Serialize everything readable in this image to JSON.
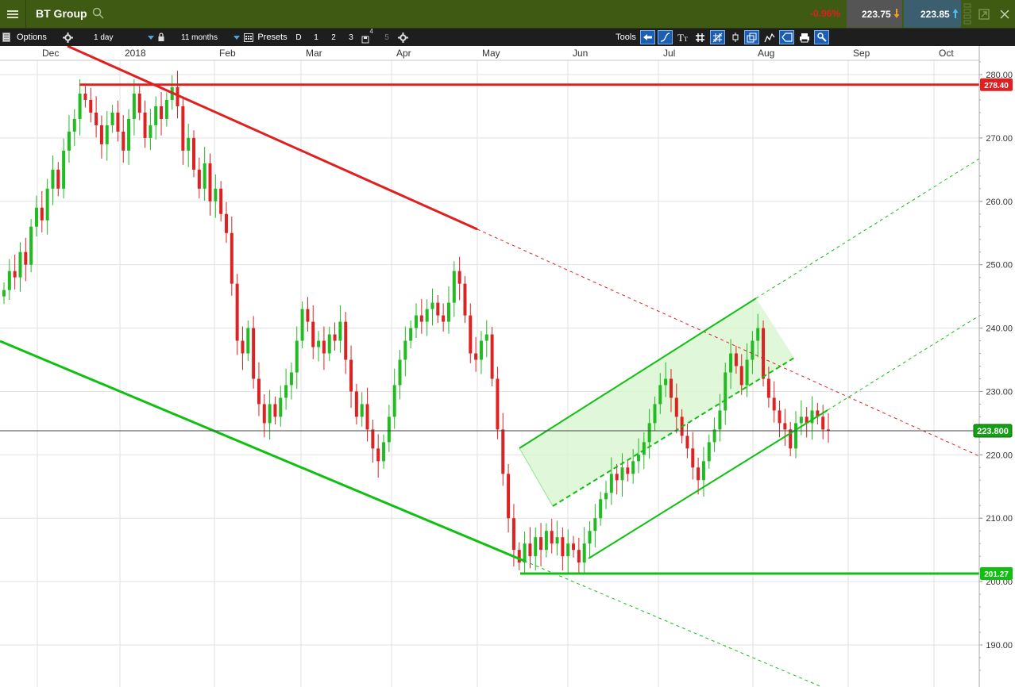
{
  "header": {
    "title": "BT Group",
    "change": "-0.96%",
    "sell_price": "223.75",
    "buy_price": "223.85"
  },
  "toolbar": {
    "options_label": "Options",
    "interval": "1 day",
    "range": "11 months",
    "presets_label": "Presets",
    "presets": [
      "D",
      "1",
      "2",
      "3",
      "4",
      "5"
    ],
    "tools_label": "Tools"
  },
  "colors": {
    "header_bg": "#3f5a12",
    "toolbar_bg": "#1e1e1e",
    "up_candle": "#22bb22",
    "down_candle": "#dd2222",
    "resistance": "#e02020",
    "support": "#10c010",
    "channel_fill": "#d8f5d0"
  },
  "chart_data": {
    "type": "candlestick",
    "x_tick_labels": [
      "Dec",
      "2018",
      "Feb",
      "Mar",
      "Apr",
      "May",
      "Jun",
      "Jul",
      "Aug",
      "Sep",
      "Oct"
    ],
    "y_tick_labels": [
      "280.00",
      "270.00",
      "260.00",
      "250.00",
      "240.00",
      "230.00",
      "220.00",
      "210.00",
      "200.00",
      "190.00"
    ],
    "ylim": [
      184,
      282
    ],
    "grid": true,
    "current_price_label": "223.800",
    "resistance_label": "278.40",
    "support_label": "201.27",
    "closes": [
      246,
      249,
      248,
      252,
      250,
      256,
      259,
      257,
      262,
      265,
      262,
      268,
      271,
      273,
      277,
      276,
      274,
      272,
      269,
      272,
      274,
      271,
      268,
      273,
      277,
      274,
      270,
      272,
      275,
      273,
      276,
      278,
      275,
      268,
      270,
      265,
      262,
      266,
      260,
      262,
      258,
      255,
      247,
      238,
      236,
      240,
      232,
      228,
      225,
      228,
      226,
      229,
      231,
      233,
      238,
      243,
      241,
      237,
      238,
      236,
      239,
      238,
      241,
      235,
      230,
      226,
      228,
      224,
      221,
      219,
      222,
      226,
      231,
      235,
      238,
      240,
      242,
      241,
      243,
      244,
      242,
      241,
      244,
      249,
      247,
      242,
      236,
      235,
      238,
      239,
      232,
      224,
      217,
      210,
      205,
      203,
      206,
      204,
      207,
      205,
      208,
      206,
      207,
      204,
      206,
      205,
      203,
      206,
      208,
      210,
      213,
      214,
      217,
      216,
      218,
      217,
      219,
      220,
      222,
      225,
      228,
      231,
      232,
      229,
      226,
      223,
      221,
      218,
      216,
      219,
      222,
      224,
      227,
      233,
      236,
      234,
      231,
      235,
      238,
      240,
      232,
      229,
      227,
      225,
      224,
      221,
      225,
      226,
      225,
      227,
      226,
      224,
      223.8
    ]
  }
}
